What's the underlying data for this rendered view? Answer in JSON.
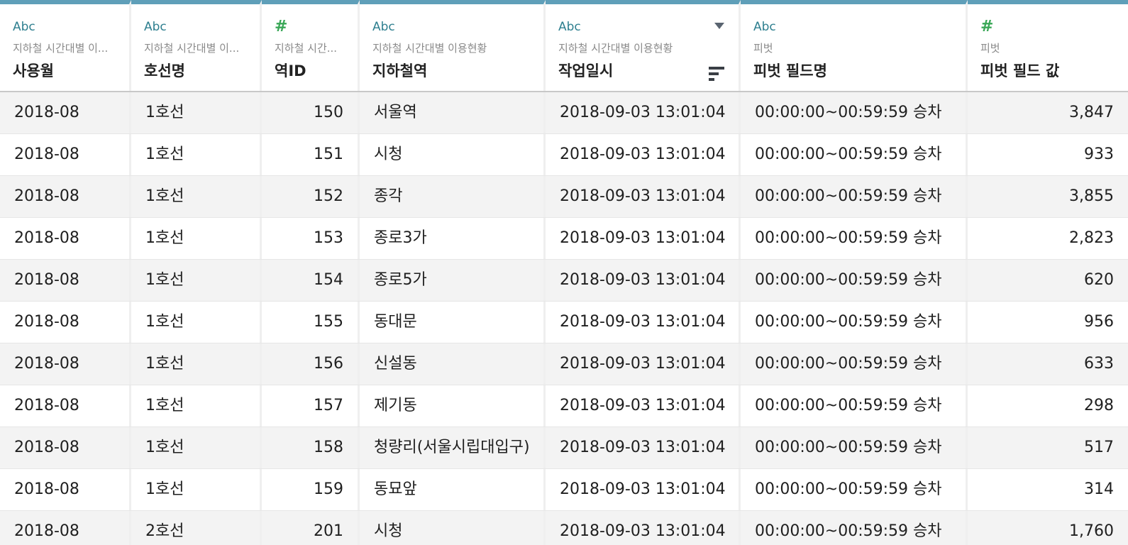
{
  "columns": [
    {
      "type": "Abc",
      "type_kind": "string",
      "source": "지하철 시간대별 이...",
      "name": "사용월"
    },
    {
      "type": "Abc",
      "type_kind": "string",
      "source": "지하철 시간대별 이...",
      "name": "호선명"
    },
    {
      "type": "#",
      "type_kind": "number",
      "source": "지하철 시간...",
      "name": "역ID"
    },
    {
      "type": "Abc",
      "type_kind": "string",
      "source": "지하철 시간대별 이용현황",
      "name": "지하철역"
    },
    {
      "type": "Abc",
      "type_kind": "string",
      "source": "지하철 시간대별 이용현황",
      "name": "작업일시"
    },
    {
      "type": "Abc",
      "type_kind": "string",
      "source": "피벗",
      "name": "피벗 필드명"
    },
    {
      "type": "#",
      "type_kind": "number",
      "source": "피벗",
      "name": "피벗 필드 값"
    }
  ],
  "rows": [
    [
      "2018-08",
      "1호선",
      "150",
      "서울역",
      "2018-09-03 13:01:04",
      "00:00:00~00:59:59 승차",
      "3,847"
    ],
    [
      "2018-08",
      "1호선",
      "151",
      "시청",
      "2018-09-03 13:01:04",
      "00:00:00~00:59:59 승차",
      "933"
    ],
    [
      "2018-08",
      "1호선",
      "152",
      "종각",
      "2018-09-03 13:01:04",
      "00:00:00~00:59:59 승차",
      "3,855"
    ],
    [
      "2018-08",
      "1호선",
      "153",
      "종로3가",
      "2018-09-03 13:01:04",
      "00:00:00~00:59:59 승차",
      "2,823"
    ],
    [
      "2018-08",
      "1호선",
      "154",
      "종로5가",
      "2018-09-03 13:01:04",
      "00:00:00~00:59:59 승차",
      "620"
    ],
    [
      "2018-08",
      "1호선",
      "155",
      "동대문",
      "2018-09-03 13:01:04",
      "00:00:00~00:59:59 승차",
      "956"
    ],
    [
      "2018-08",
      "1호선",
      "156",
      "신설동",
      "2018-09-03 13:01:04",
      "00:00:00~00:59:59 승차",
      "633"
    ],
    [
      "2018-08",
      "1호선",
      "157",
      "제기동",
      "2018-09-03 13:01:04",
      "00:00:00~00:59:59 승차",
      "298"
    ],
    [
      "2018-08",
      "1호선",
      "158",
      "청량리(서울시립대입구)",
      "2018-09-03 13:01:04",
      "00:00:00~00:59:59 승차",
      "517"
    ],
    [
      "2018-08",
      "1호선",
      "159",
      "동묘앞",
      "2018-09-03 13:01:04",
      "00:00:00~00:59:59 승차",
      "314"
    ],
    [
      "2018-08",
      "2호선",
      "201",
      "시청",
      "2018-09-03 13:01:04",
      "00:00:00~00:59:59 승차",
      "1,760"
    ]
  ],
  "colors": {
    "header_accent": "#5f9fb9",
    "string_type": "#2e7f8f",
    "number_type": "#3aa757",
    "alt_row": "#f3f3f3"
  },
  "icons": {
    "string_type": "abc-type-icon",
    "number_type": "hash-type-icon",
    "dropdown": "chevron-down-icon",
    "sort": "sort-icon"
  }
}
